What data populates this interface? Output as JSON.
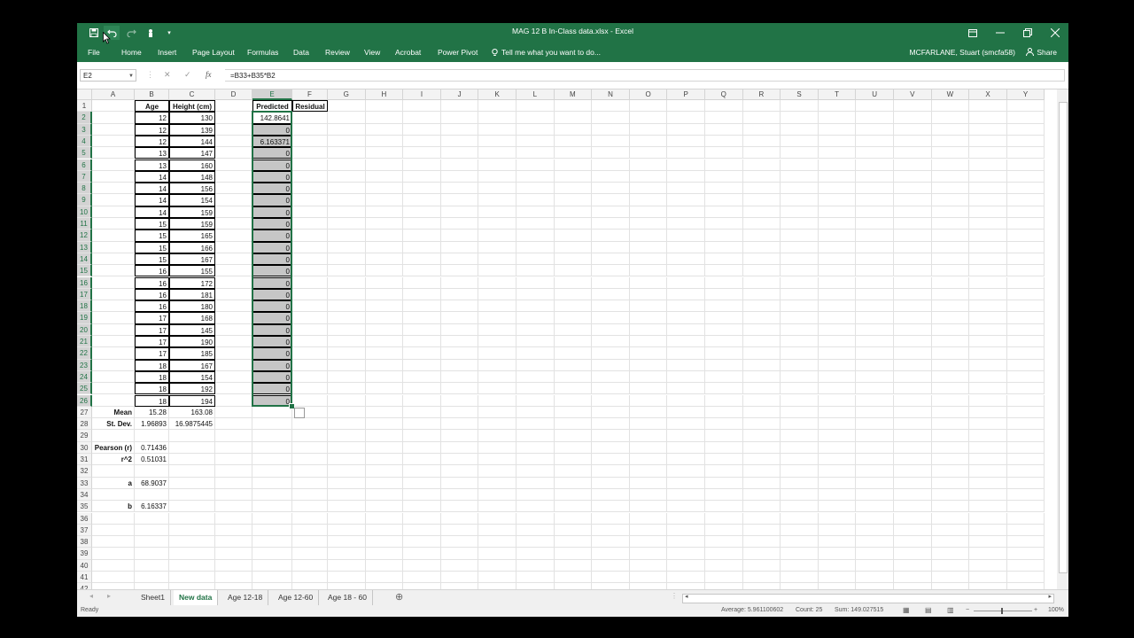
{
  "window": {
    "title": "MAG 12 B In-Class data.xlsx - Excel",
    "accent": "#217346",
    "controls": [
      "ribbon-display-icon",
      "minimize-icon",
      "restore-icon",
      "close-icon"
    ]
  },
  "quick_access": {
    "icons": [
      "save-icon",
      "undo-icon",
      "redo-icon",
      "touch-mode-icon",
      "customize-icon"
    ]
  },
  "ribbon": {
    "tabs": [
      "File",
      "Home",
      "Insert",
      "Page Layout",
      "Formulas",
      "Data",
      "Review",
      "View",
      "Acrobat",
      "Power Pivot"
    ],
    "tell_me": "Tell me what you want to do...",
    "user": "MCFARLANE, Stuart (smcfa58)",
    "share": "Share"
  },
  "formula_bar": {
    "name_box": "E2",
    "formula": "=B33+B35*B2",
    "cancel": "✕",
    "enter": "✓",
    "fx": "fx"
  },
  "columns": [
    "A",
    "B",
    "C",
    "D",
    "E",
    "F",
    "G",
    "H",
    "I",
    "J",
    "K",
    "L",
    "M",
    "N",
    "O",
    "P",
    "Q",
    "R",
    "S",
    "T",
    "U",
    "V",
    "W",
    "X",
    "Y"
  ],
  "selected_column": "E",
  "row_numbers": [
    "1",
    "2",
    "3",
    "4",
    "5",
    "6",
    "7",
    "8",
    "9",
    "10",
    "11",
    "12",
    "13",
    "14",
    "15",
    "16",
    "17",
    "18",
    "19",
    "20",
    "21",
    "22",
    "23",
    "24",
    "25",
    "26",
    "27",
    "28",
    "29",
    "30",
    "31",
    "32",
    "33",
    "34",
    "35",
    "36",
    "37",
    "38",
    "39",
    "40",
    "41",
    "42"
  ],
  "cells": {
    "headers": {
      "B1": "Age",
      "C1": "Height (cm)",
      "E1": "Predicted",
      "F1": "Residual"
    },
    "age": [
      "12",
      "12",
      "12",
      "13",
      "13",
      "14",
      "14",
      "14",
      "14",
      "15",
      "15",
      "15",
      "15",
      "16",
      "16",
      "16",
      "16",
      "17",
      "17",
      "17",
      "17",
      "18",
      "18",
      "18",
      "18"
    ],
    "height": [
      "130",
      "139",
      "144",
      "147",
      "160",
      "148",
      "156",
      "154",
      "159",
      "159",
      "165",
      "166",
      "167",
      "155",
      "172",
      "181",
      "180",
      "168",
      "145",
      "190",
      "185",
      "167",
      "154",
      "192",
      "194"
    ],
    "predicted": [
      "142.8641",
      "0",
      "6.163371",
      "0",
      "0",
      "0",
      "0",
      "0",
      "0",
      "0",
      "0",
      "0",
      "0",
      "0",
      "0",
      "0",
      "0",
      "0",
      "0",
      "0",
      "0",
      "0",
      "0",
      "0",
      "0"
    ],
    "stats": [
      {
        "row": 27,
        "label": "Mean",
        "b": "15.28",
        "c": "163.08"
      },
      {
        "row": 28,
        "label": "St. Dev.",
        "b": "1.96893",
        "c": "16.9875445"
      },
      {
        "row": 30,
        "label": "Pearson (r)",
        "b": "0.71436",
        "c": ""
      },
      {
        "row": 31,
        "label": "r^2",
        "b": "0.51031",
        "c": ""
      },
      {
        "row": 33,
        "label": "a",
        "b": "68.9037",
        "c": ""
      },
      {
        "row": 35,
        "label": "b",
        "b": "6.16337",
        "c": ""
      }
    ]
  },
  "sheets": {
    "tabs": [
      "Sheet1",
      "New data",
      "Age 12-18",
      "Age 12-60",
      "Age 18 - 60"
    ],
    "active": "New data",
    "add": "⊕"
  },
  "status": {
    "ready": "Ready",
    "average": "Average: 5.961100602",
    "count": "Count: 25",
    "sum": "Sum: 149.027515",
    "zoom": "100%"
  }
}
